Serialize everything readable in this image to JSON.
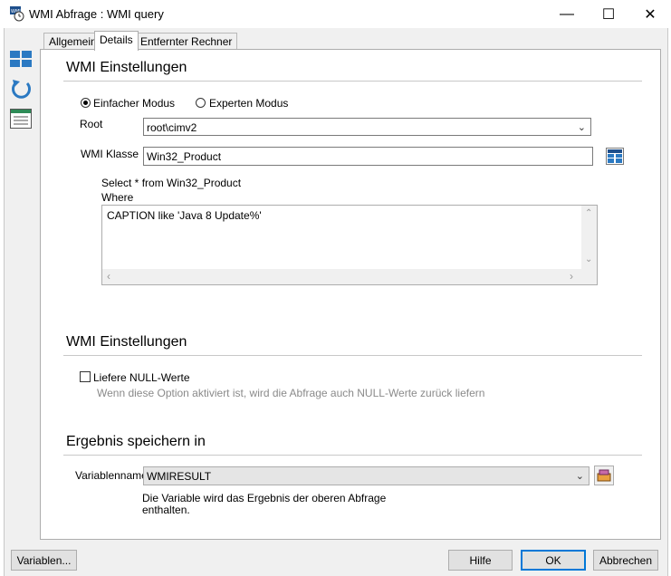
{
  "window": {
    "title": "WMI Abfrage : WMI query",
    "controls": {
      "minimize": "—",
      "maximize": "☐",
      "close": "✕"
    }
  },
  "tabs": [
    {
      "label": "Allgemein",
      "active": false
    },
    {
      "label": "Details",
      "active": true
    },
    {
      "label": "Entfernter Rechner",
      "active": false
    }
  ],
  "left_toolbar": [
    {
      "icon": "grid-icon"
    },
    {
      "icon": "refresh-icon"
    },
    {
      "icon": "list-icon"
    }
  ],
  "wmi_settings": {
    "heading": "WMI Einstellungen",
    "mode_simple": "Einfacher Modus",
    "mode_expert": "Experten Modus",
    "mode_selected": "simple",
    "root_label": "Root",
    "root_value": "root\\cimv2",
    "class_label": "WMI Klasse",
    "class_value": "Win32_Product",
    "query_preview": "Select * from Win32_Product",
    "where_label": "Where",
    "where_value": "CAPTION like 'Java 8 Update%'"
  },
  "wmi_settings2": {
    "heading": "WMI Einstellungen",
    "null_label": "Liefere NULL-Werte",
    "null_checked": false,
    "null_hint": "Wenn diese Option aktiviert ist, wird die Abfrage auch NULL-Werte zurück liefern"
  },
  "result": {
    "heading": "Ergebnis speichern in",
    "var_label": "Variablenname",
    "var_value": "WMIRESULT",
    "description_line1": "Die Variable wird das Ergebnis der oberen Abfrage",
    "description_line2": "enthalten."
  },
  "footer": {
    "variables": "Variablen...",
    "help": "Hilfe",
    "ok": "OK",
    "cancel": "Abbrechen"
  },
  "colors": {
    "accent": "#0078d7",
    "icon_blue": "#2b79c2"
  }
}
